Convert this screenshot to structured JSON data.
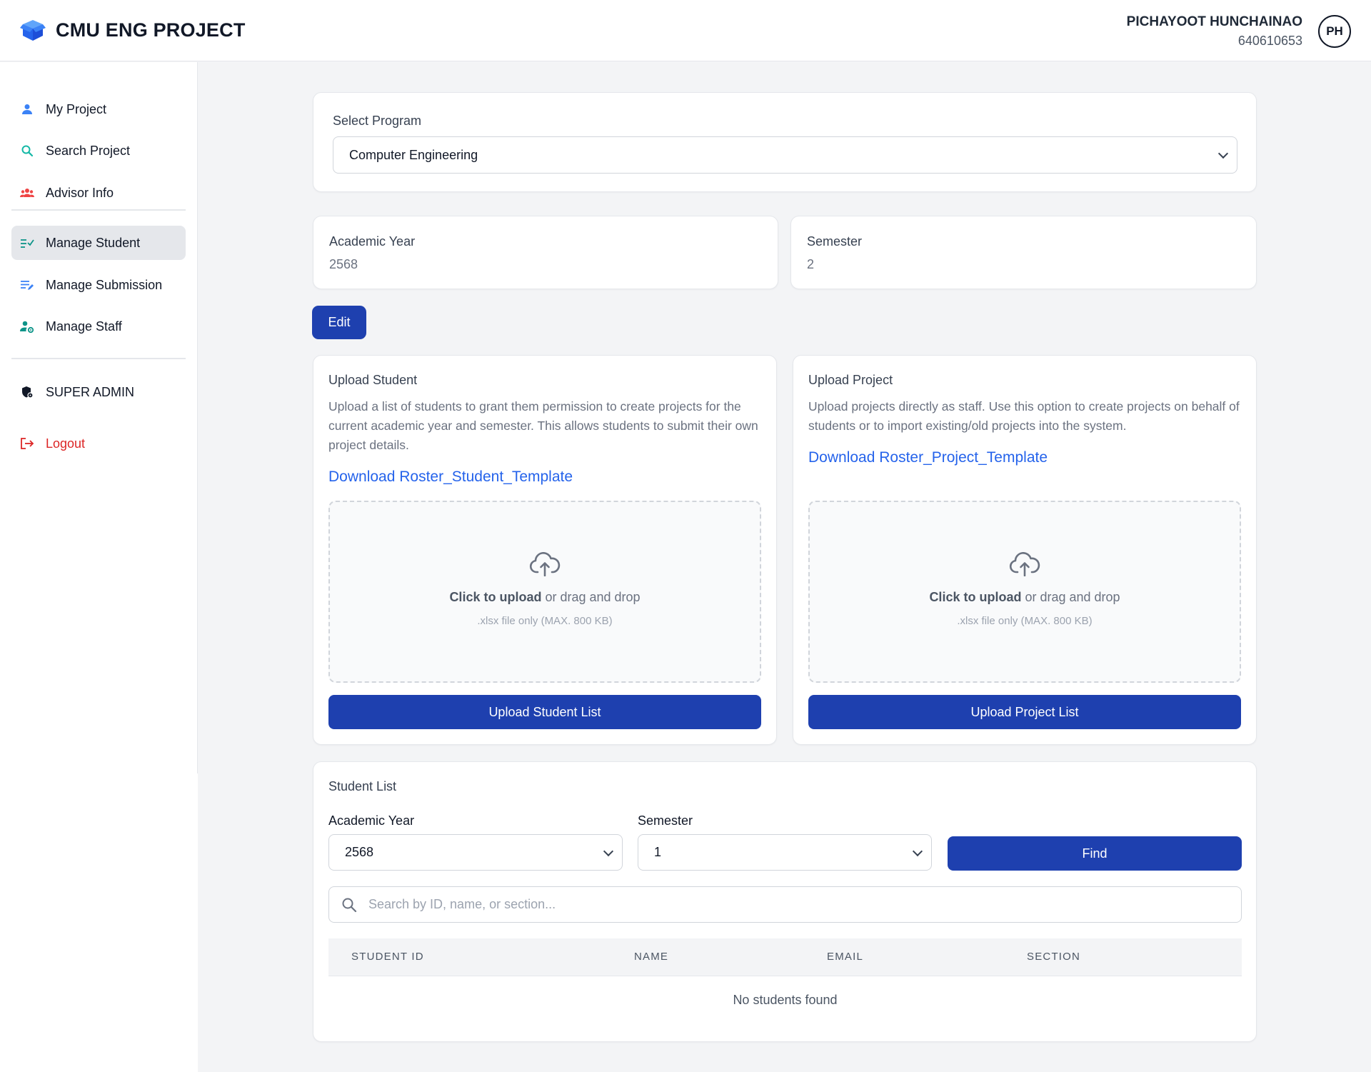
{
  "header": {
    "brand": "CMU ENG PROJECT",
    "user_name": "PICHAYOOT HUNCHAINAO",
    "user_id": "640610653",
    "avatar_initials": "PH"
  },
  "sidebar": {
    "items": [
      {
        "label": "My Project",
        "icon": "user-icon"
      },
      {
        "label": "Search Project",
        "icon": "search-icon"
      },
      {
        "label": "Advisor Info",
        "icon": "group-icon"
      },
      {
        "label": "Manage Student",
        "icon": "checklist-icon",
        "active": true
      },
      {
        "label": "Manage Submission",
        "icon": "edit-list-icon"
      },
      {
        "label": "Manage Staff",
        "icon": "user-gear-icon"
      },
      {
        "label": "SUPER ADMIN",
        "icon": "shield-icon"
      },
      {
        "label": "Logout",
        "icon": "logout-icon"
      }
    ]
  },
  "program": {
    "label": "Select Program",
    "selected": "Computer Engineering"
  },
  "term": {
    "year_label": "Academic Year",
    "year_value": "2568",
    "semester_label": "Semester",
    "semester_value": "2",
    "edit_label": "Edit"
  },
  "upload_student": {
    "title": "Upload Student",
    "description": "Upload a list of students to grant them permission to create projects for the current academic year and semester. This allows students to submit their own project details.",
    "link": "Download Roster_Student_Template",
    "dz_click": "Click to upload",
    "dz_rest": " or drag and drop",
    "dz_hint": ".xlsx file only (MAX. 800 KB)",
    "button": "Upload Student List"
  },
  "upload_project": {
    "title": "Upload Project",
    "description": "Upload projects directly as staff. Use this option to create projects on behalf of students or to import existing/old projects into the system.",
    "link": "Download Roster_Project_Template",
    "dz_click": "Click to upload",
    "dz_rest": " or drag and drop",
    "dz_hint": ".xlsx file only (MAX. 800 KB)",
    "button": "Upload Project List"
  },
  "student_list": {
    "title": "Student List",
    "year_label": "Academic Year",
    "year_selected": "2568",
    "semester_label": "Semester",
    "semester_selected": "1",
    "find_label": "Find",
    "search_placeholder": "Search by ID, name, or section...",
    "columns": [
      "STUDENT ID",
      "NAME",
      "EMAIL",
      "SECTION"
    ],
    "empty_text": "No students found"
  },
  "colors": {
    "primary": "#1e40af",
    "link": "#2563eb",
    "danger": "#dc2626"
  }
}
